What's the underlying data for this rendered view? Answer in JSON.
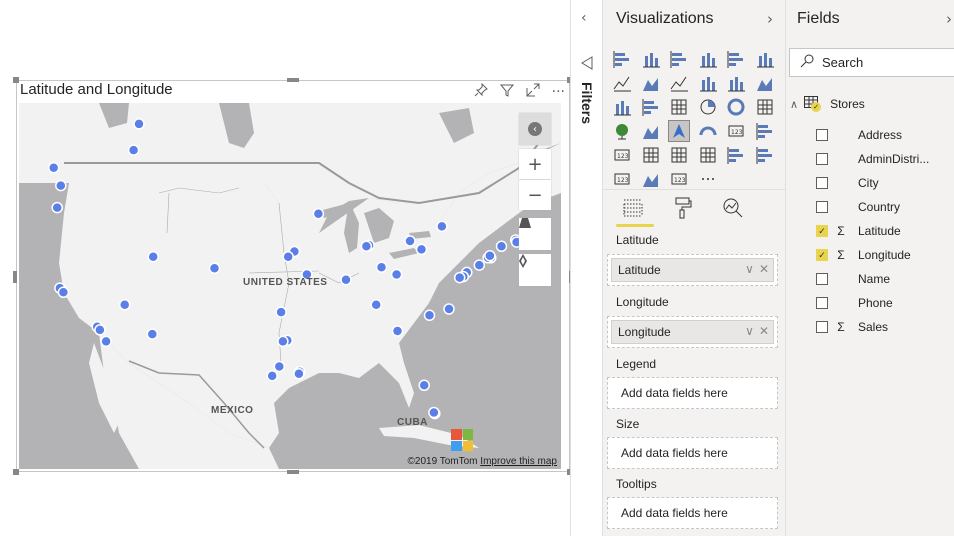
{
  "visual": {
    "title": "Latitude and Longitude",
    "header_icons": [
      "pin-icon",
      "filter-icon",
      "focus-mode-icon",
      "more-options-icon"
    ],
    "more_glyph": "···"
  },
  "map": {
    "labels": {
      "us": "UNITED STATES",
      "mexico": "MEXICO",
      "cuba": "CUBA"
    },
    "attribution": "©2019 TomTom",
    "improve_link": "Improve this map",
    "controls": {
      "zoom_in": "+",
      "zoom_out": "−"
    },
    "point_color": "#5b7fe8",
    "points": [
      {
        "lon": -113.5,
        "lat": 53.5
      },
      {
        "lon": -114.1,
        "lat": 51.0
      },
      {
        "lon": -123.1,
        "lat": 49.3
      },
      {
        "lon": -122.3,
        "lat": 47.6
      },
      {
        "lon": -122.7,
        "lat": 45.5
      },
      {
        "lon": -122.4,
        "lat": 37.8
      },
      {
        "lon": -122.0,
        "lat": 37.4
      },
      {
        "lon": -118.2,
        "lat": 34.1
      },
      {
        "lon": -117.9,
        "lat": 33.8
      },
      {
        "lon": -117.2,
        "lat": 32.7
      },
      {
        "lon": -115.1,
        "lat": 36.2
      },
      {
        "lon": -112.0,
        "lat": 33.4
      },
      {
        "lon": -111.9,
        "lat": 40.8
      },
      {
        "lon": -105.0,
        "lat": 39.7
      },
      {
        "lon": -93.3,
        "lat": 44.9
      },
      {
        "lon": -96.0,
        "lat": 41.3
      },
      {
        "lon": -94.6,
        "lat": 39.1
      },
      {
        "lon": -90.2,
        "lat": 38.6
      },
      {
        "lon": -87.6,
        "lat": 41.9
      },
      {
        "lon": -87.9,
        "lat": 41.8
      },
      {
        "lon": -86.2,
        "lat": 39.8
      },
      {
        "lon": -84.5,
        "lat": 39.1
      },
      {
        "lon": -83.0,
        "lat": 42.3
      },
      {
        "lon": -81.7,
        "lat": 41.5
      },
      {
        "lon": -79.4,
        "lat": 43.7
      },
      {
        "lon": -71.1,
        "lat": 42.4
      },
      {
        "lon": -71.0,
        "lat": 42.2
      },
      {
        "lon": -72.7,
        "lat": 41.8
      },
      {
        "lon": -73.9,
        "lat": 40.7
      },
      {
        "lon": -74.2,
        "lat": 40.7
      },
      {
        "lon": -74.0,
        "lat": 40.9
      },
      {
        "lon": -75.2,
        "lat": 40.0
      },
      {
        "lon": -76.6,
        "lat": 39.3
      },
      {
        "lon": -77.0,
        "lat": 38.9
      },
      {
        "lon": -77.4,
        "lat": 38.8
      },
      {
        "lon": -78.6,
        "lat": 35.8
      },
      {
        "lon": -80.8,
        "lat": 35.2
      },
      {
        "lon": -84.4,
        "lat": 33.7
      },
      {
        "lon": -86.8,
        "lat": 36.2
      },
      {
        "lon": -97.5,
        "lat": 35.5
      },
      {
        "lon": -96.8,
        "lat": 32.8
      },
      {
        "lon": -97.3,
        "lat": 32.7
      },
      {
        "lon": -97.7,
        "lat": 30.3
      },
      {
        "lon": -98.5,
        "lat": 29.4
      },
      {
        "lon": -95.4,
        "lat": 29.8
      },
      {
        "lon": -95.5,
        "lat": 29.6
      },
      {
        "lon": -81.4,
        "lat": 28.5
      },
      {
        "lon": -80.2,
        "lat": 25.8
      },
      {
        "lon": -80.3,
        "lat": 25.9
      },
      {
        "lon": -96.7,
        "lat": 40.8
      }
    ]
  },
  "filters_pane": {
    "label": "Filters",
    "collapse": "‹"
  },
  "visualizations": {
    "title": "Visualizations",
    "chevron": "›",
    "icons": [
      "stacked-bar-icon",
      "stacked-column-icon",
      "clustered-bar-icon",
      "clustered-column-icon",
      "100-stacked-bar-icon",
      "100-stacked-column-icon",
      "line-chart-icon",
      "area-chart-icon",
      "stacked-area-icon",
      "line-column-icon",
      "line-clustered-column-icon",
      "ribbon-chart-icon",
      "waterfall-icon",
      "funnel-icon",
      "scatter-icon",
      "pie-icon",
      "donut-icon",
      "treemap-icon",
      "map-icon",
      "filled-map-icon",
      "azure-map-icon",
      "gauge-icon",
      "card-icon",
      "multi-row-card-icon",
      "kpi-icon",
      "slicer-icon",
      "table-icon",
      "matrix-icon",
      "key-influencers-icon",
      "decomposition-tree-icon",
      "qna-icon",
      "arcgis-icon",
      "power-apps-icon",
      "more-visuals-icon"
    ],
    "selected_index": 20,
    "tabs": [
      "fields-tab",
      "format-tab",
      "analytics-tab"
    ],
    "wells": [
      {
        "label": "Latitude",
        "value": "Latitude"
      },
      {
        "label": "Longitude",
        "value": "Longitude"
      },
      {
        "label": "Legend",
        "placeholder": "Add data fields here"
      },
      {
        "label": "Size",
        "placeholder": "Add data fields here"
      },
      {
        "label": "Tooltips",
        "placeholder": "Add data fields here"
      }
    ]
  },
  "fields": {
    "title": "Fields",
    "chevron": "›",
    "search_placeholder": "Search",
    "table": "Stores",
    "items": [
      {
        "name": "Address",
        "checked": false,
        "sigma": false
      },
      {
        "name": "AdminDistri...",
        "checked": false,
        "sigma": false
      },
      {
        "name": "City",
        "checked": false,
        "sigma": false
      },
      {
        "name": "Country",
        "checked": false,
        "sigma": false
      },
      {
        "name": "Latitude",
        "checked": true,
        "sigma": true
      },
      {
        "name": "Longitude",
        "checked": true,
        "sigma": true
      },
      {
        "name": "Name",
        "checked": false,
        "sigma": false
      },
      {
        "name": "Phone",
        "checked": false,
        "sigma": false
      },
      {
        "name": "Sales",
        "checked": false,
        "sigma": true
      }
    ]
  }
}
